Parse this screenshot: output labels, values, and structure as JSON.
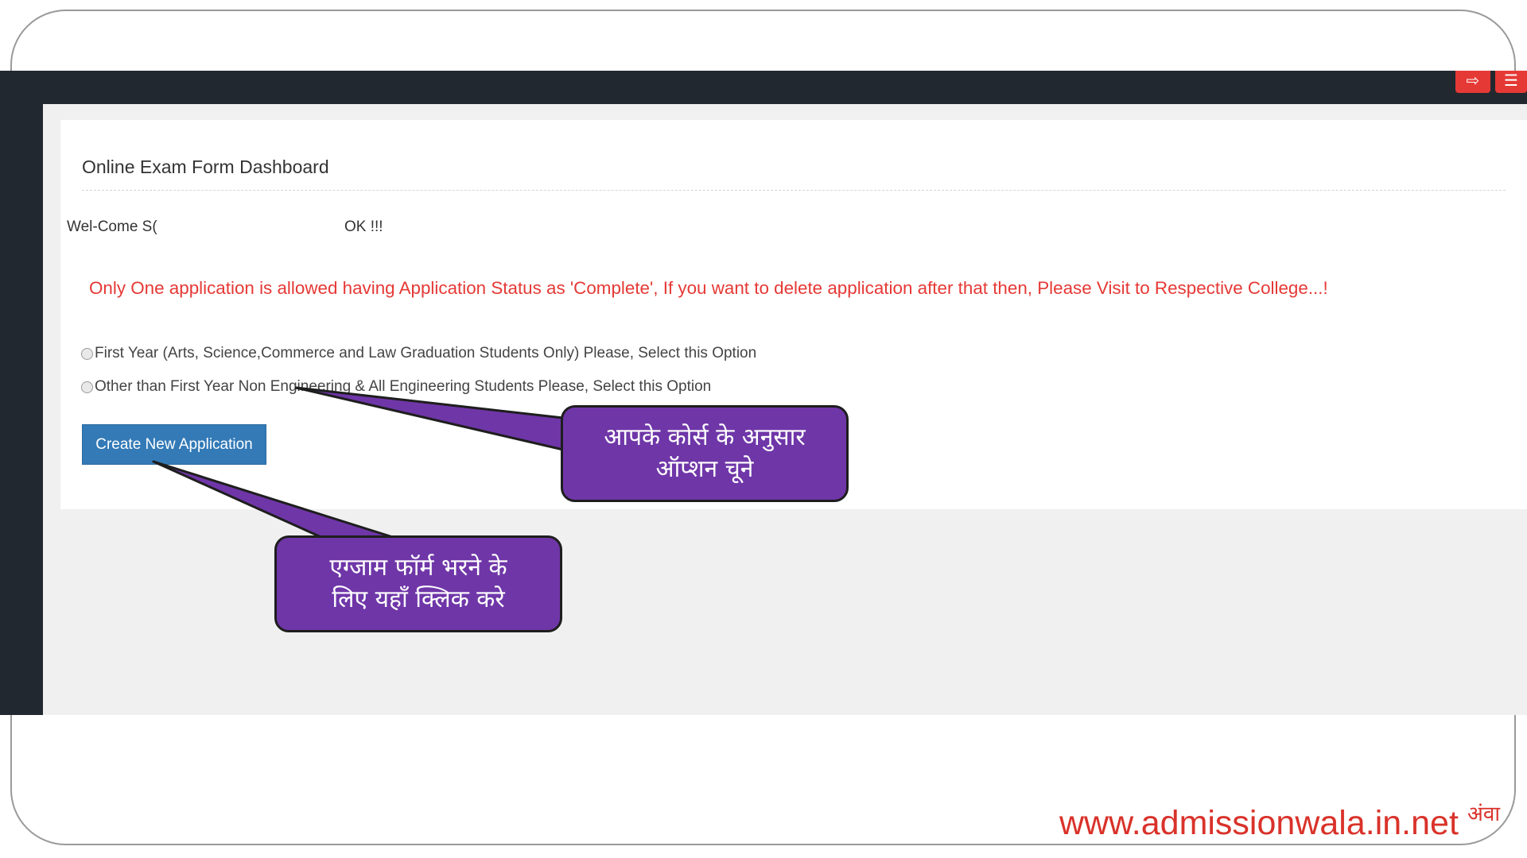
{
  "dashboard": {
    "title": "Online Exam Form Dashboard",
    "welcome_left": "Wel-Come S(",
    "welcome_right": "OK !!!",
    "notice": "Only One application is allowed having Application Status as 'Complete', If you want to delete application after that then, Please Visit to Respective College...!",
    "options": [
      {
        "label": "First Year (Arts, Science,Commerce and Law Graduation Students Only) Please, Select this Option",
        "checked": false
      },
      {
        "label": "Other than First Year Non Engineering & All Engineering Students Please, Select this Option",
        "checked": false
      }
    ],
    "create_button": "Create New Application"
  },
  "topbar": {
    "buttons": [
      {
        "icon": "logout-icon",
        "glyph": "⇨"
      },
      {
        "icon": "menu-icon",
        "glyph": "☰"
      }
    ]
  },
  "callouts": {
    "options_hint": [
      "आपके कोर्स के अनुसार",
      "ऑप्शन चूने"
    ],
    "button_hint": [
      "एग्जाम फॉर्म भरने के",
      "लिए यहाँ क्लिक करे"
    ]
  },
  "footer": {
    "url": "www.admissionwala.in.net",
    "logo_text": "अंवा"
  },
  "colors": {
    "notice": "#e53935",
    "button": "#337ab7",
    "callout": "#6f36a8",
    "bar": "#222830"
  }
}
